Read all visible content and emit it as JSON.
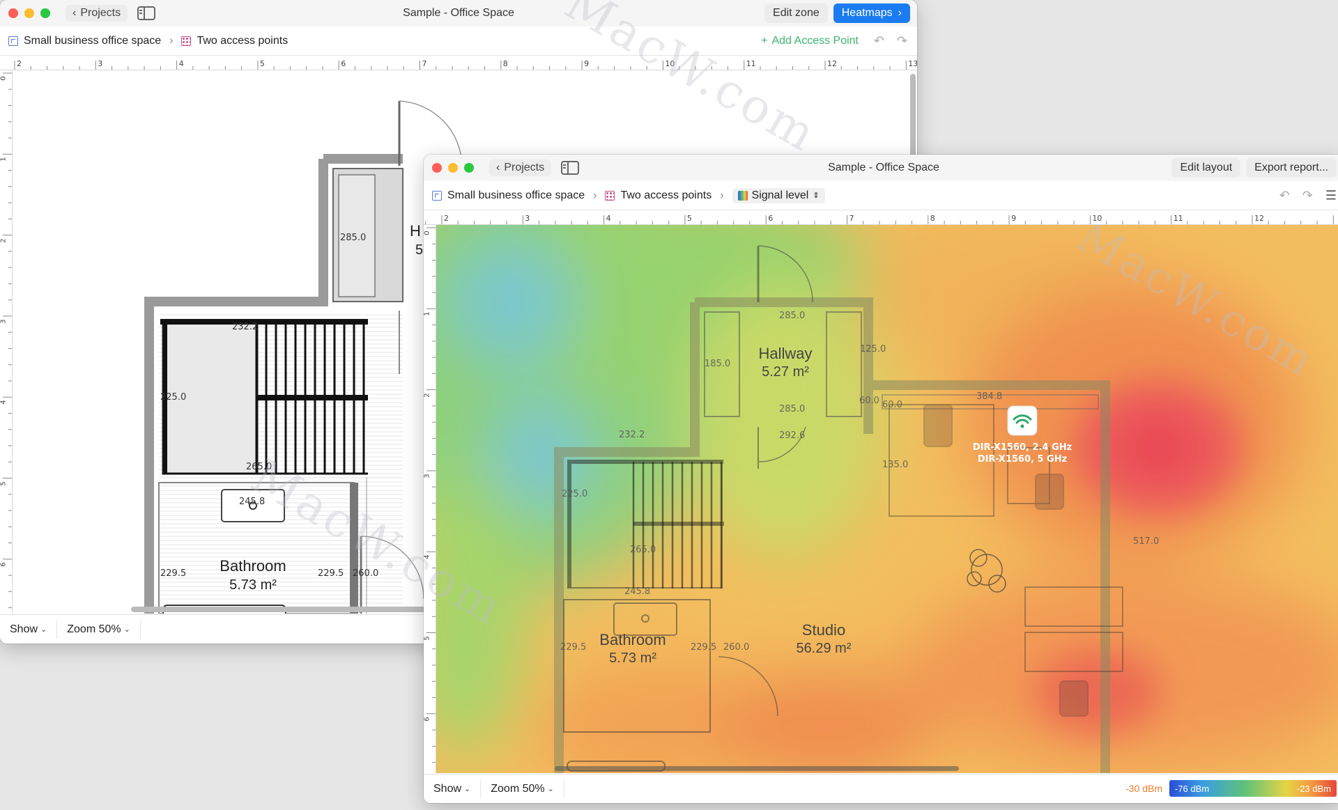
{
  "back_window": {
    "title": "Sample - Office Space",
    "back_label": "Projects",
    "toolbar": {
      "edit_zone": "Edit zone",
      "heatmaps": "Heatmaps"
    },
    "breadcrumb": {
      "project": "Small business office space",
      "ap_group": "Two access points"
    },
    "add_ap": "Add Access Point",
    "ruler_h": [
      "2",
      "3",
      "4",
      "5",
      "6",
      "7",
      "8",
      "9",
      "10",
      "11",
      "12",
      "13"
    ],
    "ruler_v": [
      "0",
      "1",
      "2",
      "3",
      "4",
      "5",
      "6"
    ],
    "rooms": {
      "bathroom_name": "Bathroom",
      "bathroom_area": "5.73 m²",
      "hallway_name_partial": "H",
      "hallway_area_partial": "5"
    },
    "dims": {
      "d1": "285.0",
      "d2": "232.2",
      "d3": "225.0",
      "d4": "265.0",
      "d5": "245.8",
      "d6": "229.5",
      "d7": "229.5",
      "d8": "260.0"
    },
    "statusbar": {
      "show": "Show",
      "zoom": "Zoom 50%"
    }
  },
  "front_window": {
    "title": "Sample - Office Space",
    "back_label": "Projects",
    "toolbar": {
      "edit_layout": "Edit layout",
      "export": "Export report..."
    },
    "breadcrumb": {
      "project": "Small business office space",
      "ap_group": "Two access points",
      "mode": "Signal level"
    },
    "ruler_h": [
      "2",
      "3",
      "4",
      "5",
      "6",
      "7",
      "8",
      "9",
      "10",
      "11",
      "12"
    ],
    "ruler_v": [
      "0",
      "1",
      "2",
      "3",
      "4",
      "5",
      "6"
    ],
    "rooms": {
      "hallway_name": "Hallway",
      "hallway_area": "5.27 m²",
      "bathroom_name": "Bathroom",
      "bathroom_area": "5.73 m²",
      "studio_name": "Studio",
      "studio_area": "56.29 m²"
    },
    "dims": {
      "h_top": "285.0",
      "h_left": "185.0",
      "h_right": "125.0",
      "h_bottom": "285.0",
      "door": "292.6",
      "stairs_top": "232.2",
      "stairs_left": "225.0",
      "stairs_bottom": "265.0",
      "bath_sink": "245.8",
      "bath_l": "229.5",
      "bath_r": "229.5",
      "bath_r2": "260.0",
      "studio_top": "384.8",
      "s_60a": "60.0",
      "s_60b": "60.0",
      "s_135": "135.0",
      "s_517": "517.0"
    },
    "access_point": {
      "label_1": "DIR-X1560, 2.4 GHz",
      "label_2": "DIR-X1560, 5 GHz",
      "icon": "wifi-icon"
    },
    "statusbar": {
      "show": "Show",
      "zoom": "Zoom 50%"
    },
    "legend": {
      "current": "-30 dBm",
      "min": "-76 dBm",
      "max": "-23 dBm"
    }
  },
  "watermark": "MacW.com",
  "colors": {
    "accent": "#1a7cf0",
    "add_green": "#3bb46e",
    "heat_red": "#e6463c",
    "heat_green": "#5ec27a"
  }
}
